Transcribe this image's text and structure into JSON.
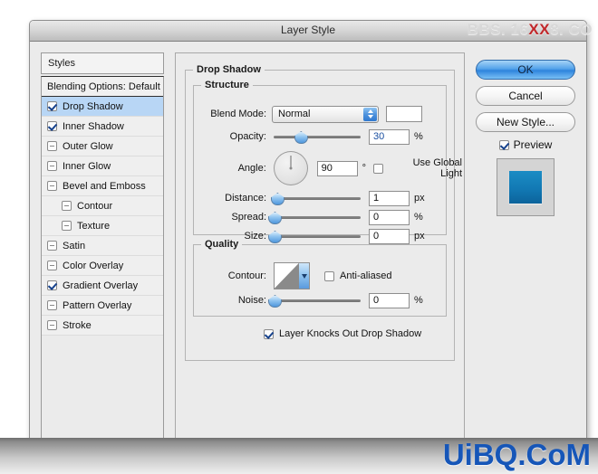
{
  "window": {
    "title": "Layer Style"
  },
  "watermarks": {
    "top_prefix": "BBS. 16",
    "top_xx": "XX",
    "top_suffix": "8. CO",
    "bottom": "UiBQ.CoM"
  },
  "styles_panel": {
    "header": "Styles",
    "blending_options": "Blending Options: Default",
    "items": [
      {
        "label": "Drop Shadow",
        "checked": true,
        "selected": true,
        "indent": false
      },
      {
        "label": "Inner Shadow",
        "checked": true,
        "selected": false,
        "indent": false
      },
      {
        "label": "Outer Glow",
        "checked": false,
        "selected": false,
        "indent": false
      },
      {
        "label": "Inner Glow",
        "checked": false,
        "selected": false,
        "indent": false
      },
      {
        "label": "Bevel and Emboss",
        "checked": false,
        "selected": false,
        "indent": false
      },
      {
        "label": "Contour",
        "checked": false,
        "selected": false,
        "indent": true
      },
      {
        "label": "Texture",
        "checked": false,
        "selected": false,
        "indent": true
      },
      {
        "label": "Satin",
        "checked": false,
        "selected": false,
        "indent": false
      },
      {
        "label": "Color Overlay",
        "checked": false,
        "selected": false,
        "indent": false
      },
      {
        "label": "Gradient Overlay",
        "checked": true,
        "selected": false,
        "indent": false
      },
      {
        "label": "Pattern Overlay",
        "checked": false,
        "selected": false,
        "indent": false
      },
      {
        "label": "Stroke",
        "checked": false,
        "selected": false,
        "indent": false
      }
    ]
  },
  "drop_shadow": {
    "group_title": "Drop Shadow",
    "structure": {
      "group_title": "Structure",
      "blend_mode": {
        "label": "Blend Mode:",
        "value": "Normal",
        "color": "#ffffff"
      },
      "opacity": {
        "label": "Opacity:",
        "value": "30",
        "unit": "%",
        "percent": 30
      },
      "angle": {
        "label": "Angle:",
        "value": "90",
        "unit": "°",
        "use_global_light_label": "Use Global Light",
        "use_global_light_checked": false
      },
      "distance": {
        "label": "Distance:",
        "value": "1",
        "unit": "px",
        "percent": 3
      },
      "spread": {
        "label": "Spread:",
        "value": "0",
        "unit": "%",
        "percent": 0
      },
      "size": {
        "label": "Size:",
        "value": "0",
        "unit": "px",
        "percent": 0
      }
    },
    "quality": {
      "group_title": "Quality",
      "contour": {
        "label": "Contour:"
      },
      "anti_aliased": {
        "label": "Anti-aliased",
        "checked": false
      },
      "noise": {
        "label": "Noise:",
        "value": "0",
        "unit": "%",
        "percent": 0
      },
      "layer_knocks_out": {
        "label": "Layer Knocks Out Drop Shadow",
        "checked": true
      }
    }
  },
  "buttons": {
    "ok": "OK",
    "cancel": "Cancel",
    "new_style": "New Style...",
    "preview_label": "Preview",
    "preview_checked": true
  },
  "colors": {
    "accent": "#2e84dd",
    "selection": "#b8d6f5",
    "dialog_bg": "#ebebeb",
    "watermark_blue": "#1656b8",
    "watermark_red": "#c1282b"
  }
}
